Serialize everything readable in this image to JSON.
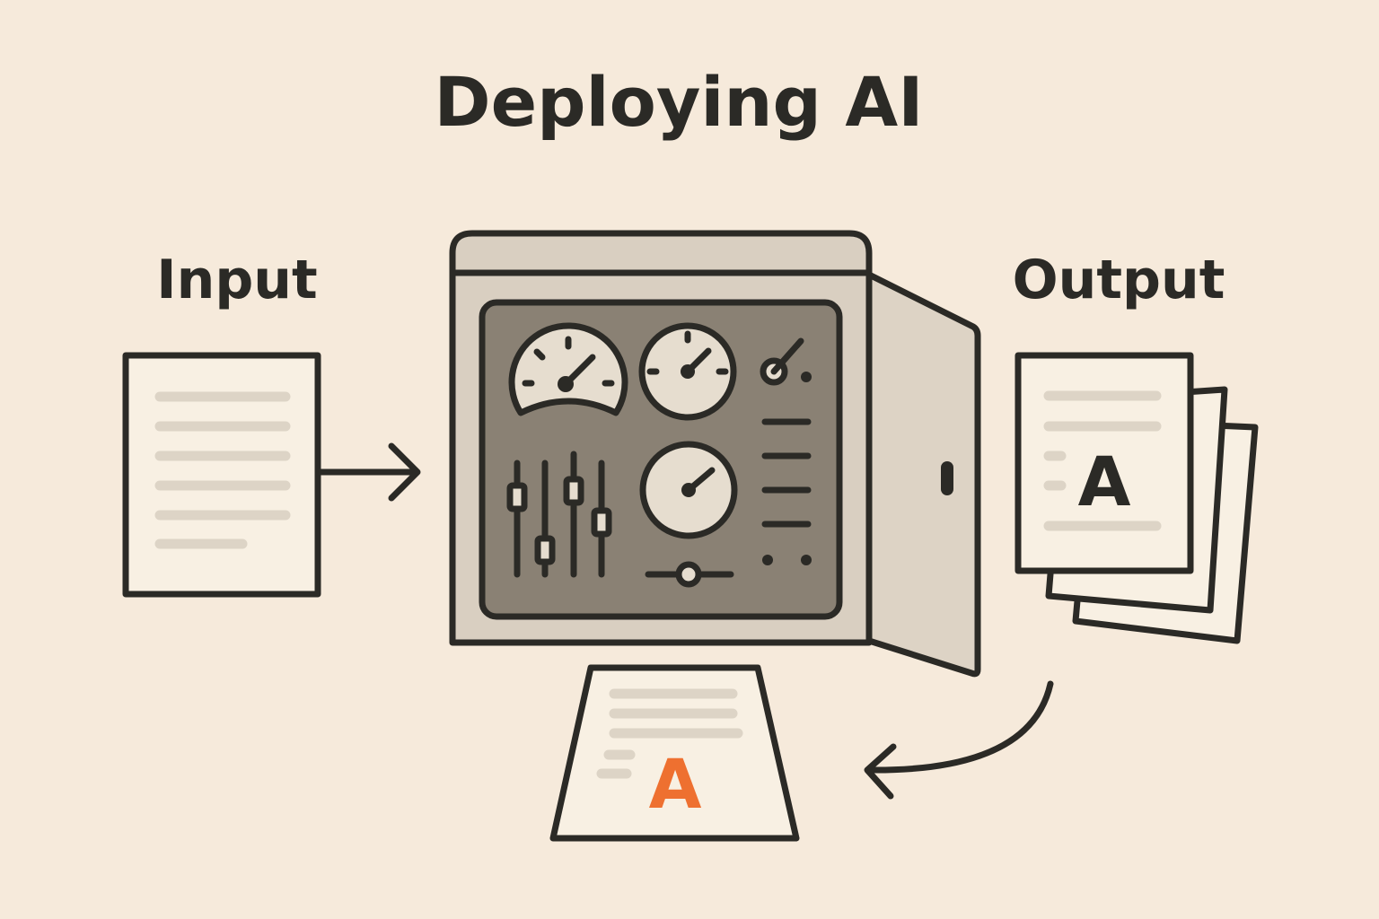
{
  "title": "Deploying AI",
  "input_label": "Input",
  "output_label": "Output",
  "output_letter": "A",
  "deployed_letter": "A",
  "colors": {
    "background": "#f6eadb",
    "outline": "#2b2a26",
    "paper": "#f8f0e3",
    "text_line": "#ddd4c6",
    "machine_body": "#d9cfc1",
    "machine_panel": "#8a8174",
    "accent": "#ee7030"
  },
  "icons": [
    "document-icon",
    "arrow-right-icon",
    "control-panel-machine-icon",
    "gauge-icon",
    "slider-icon",
    "document-stack-icon",
    "curved-arrow-icon",
    "deployed-document-icon"
  ]
}
